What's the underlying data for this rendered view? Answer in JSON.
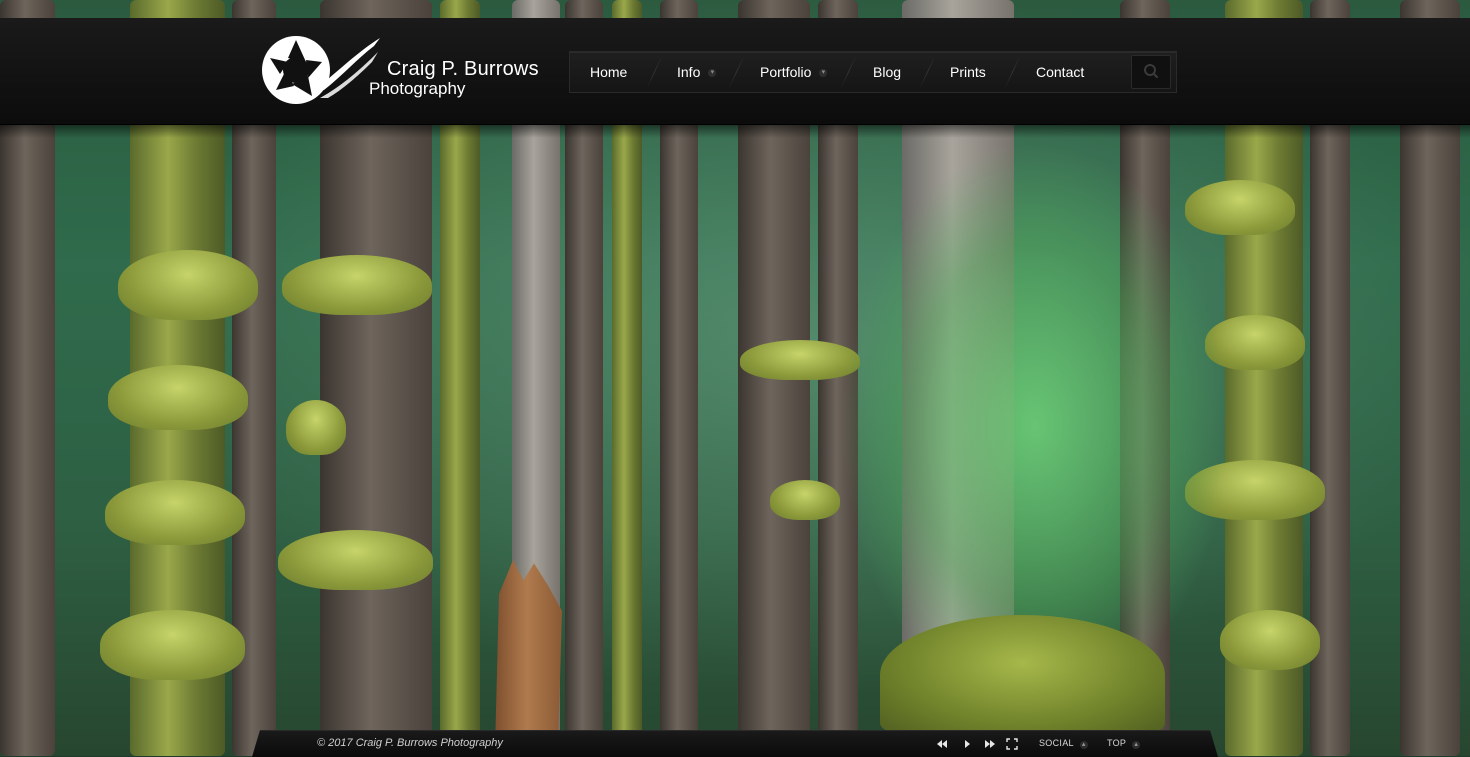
{
  "site": {
    "title_line1": "Craig P. Burrows",
    "title_line2": "Photography"
  },
  "nav": {
    "items": [
      {
        "label": "Home",
        "has_submenu": false
      },
      {
        "label": "Info",
        "has_submenu": true
      },
      {
        "label": "Portfolio",
        "has_submenu": true
      },
      {
        "label": "Blog",
        "has_submenu": false
      },
      {
        "label": "Prints",
        "has_submenu": false
      },
      {
        "label": "Contact",
        "has_submenu": false
      }
    ],
    "search_icon": "search-icon",
    "submenu_icon": "chevron-down-icon"
  },
  "footer": {
    "copyright": "© 2017 Craig P. Burrows Photography",
    "controls": {
      "prev_icon": "previous-icon",
      "play_icon": "play-icon",
      "next_icon": "next-icon",
      "fullscreen_icon": "fullscreen-icon"
    },
    "social_label": "SOCIAL",
    "top_label": "TOP"
  },
  "colors": {
    "header_bg": "#111111",
    "text": "#ffffff"
  }
}
